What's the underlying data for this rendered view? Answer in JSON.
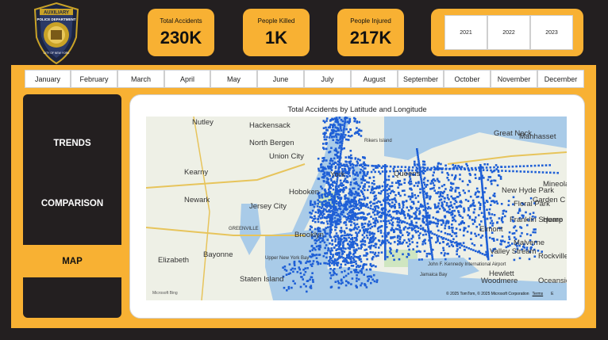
{
  "badge": {
    "top_text": "AUXILIARY",
    "middle_text": "POLICE DEPARTMENT",
    "bottom_text": "CITY OF NEW YORK"
  },
  "kpis": [
    {
      "label": "Total Accidents",
      "value": "230K"
    },
    {
      "label": "People Killed",
      "value": "1K"
    },
    {
      "label": "People Injured",
      "value": "217K"
    }
  ],
  "years": [
    "2021",
    "2022",
    "2023"
  ],
  "months": [
    "January",
    "February",
    "March",
    "April",
    "May",
    "June",
    "July",
    "August",
    "September",
    "October",
    "November",
    "December"
  ],
  "nav": {
    "trends": "TRENDS",
    "comparison": "COMPARISON",
    "map": "MAP",
    "active": "MAP"
  },
  "map": {
    "title": "Total Accidents by Latitude and Longitude",
    "place_labels": [
      "Nutley",
      "Hackensack",
      "North Bergen",
      "Union City",
      "Kearny",
      "Newark",
      "Hoboken",
      "Jersey City",
      "Bayonne",
      "Elizabeth",
      "Upper New York Bay",
      "Staten Island",
      "Brooklyn",
      "York",
      "Queens",
      "Rikers Island",
      "Great Neck",
      "Manhasset",
      "Mineola",
      "New Hyde Park",
      "Floral Park",
      "Garden C",
      "Franklin Square",
      "Hemp",
      "Elmont",
      "Malverne",
      "Valley Stream",
      "Rockville Centre",
      "Hewlett",
      "Oceanside",
      "Woodmere",
      "John F. Kennedy International Airport",
      "GREENVILLE",
      "Jamaica Bay"
    ],
    "copyright": "© 2025 TomTom, © 2025 Microsoft Corporation",
    "terms": "Terms",
    "edge_char": "E",
    "provider": "Microsoft Bing",
    "colors": {
      "points": "#1e5fd6",
      "water": "#a9cbe8",
      "land": "#eef0e6",
      "park": "#cfe6c0"
    }
  },
  "colors": {
    "accent": "#f8b133",
    "dark": "#231f20"
  }
}
